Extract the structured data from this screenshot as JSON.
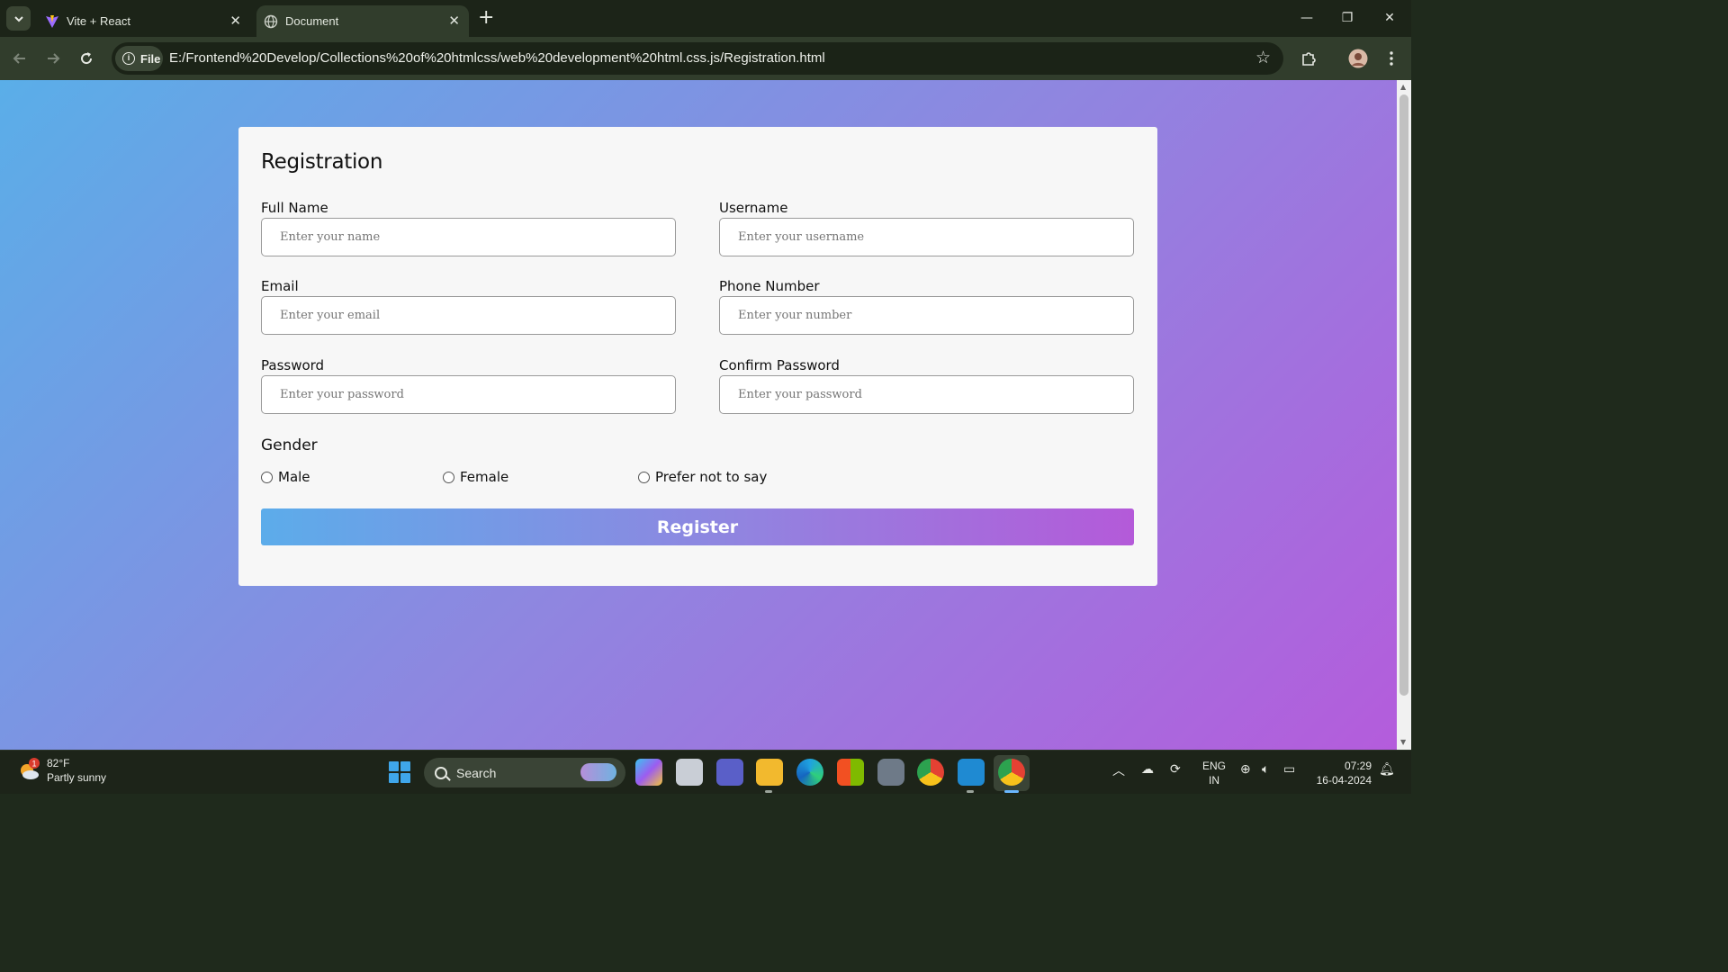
{
  "browser": {
    "tabs": [
      {
        "title": "Vite + React",
        "active": false
      },
      {
        "title": "Document",
        "active": true
      }
    ],
    "site_info_label": "File",
    "url": "E:/Frontend%20Develop/Collections%20of%20htmlcss/web%20development%20html.css.js/Registration.html"
  },
  "form": {
    "title": "Registration",
    "fields": {
      "full_name": {
        "label": "Full Name",
        "placeholder": "Enter your name"
      },
      "username": {
        "label": "Username",
        "placeholder": "Enter your username"
      },
      "email": {
        "label": "Email",
        "placeholder": "Enter your email"
      },
      "phone": {
        "label": "Phone Number",
        "placeholder": "Enter your number"
      },
      "password": {
        "label": "Password",
        "placeholder": "Enter your password"
      },
      "confirm_password": {
        "label": "Confirm Password",
        "placeholder": "Enter your password"
      }
    },
    "gender": {
      "title": "Gender",
      "options": [
        "Male",
        "Female",
        "Prefer not to say"
      ]
    },
    "submit_label": "Register"
  },
  "taskbar": {
    "weather_temp": "82°F",
    "weather_desc": "Partly sunny",
    "weather_badge": "1",
    "search_label": "Search",
    "lang_top": "ENG",
    "lang_bottom": "IN",
    "time": "07:29",
    "date": "16-04-2024"
  },
  "colors": {
    "gradient_start": "#5aaee8",
    "gradient_end": "#b45cdc",
    "card_bg": "#f7f7f7",
    "browser_chrome": "#313d2c"
  }
}
